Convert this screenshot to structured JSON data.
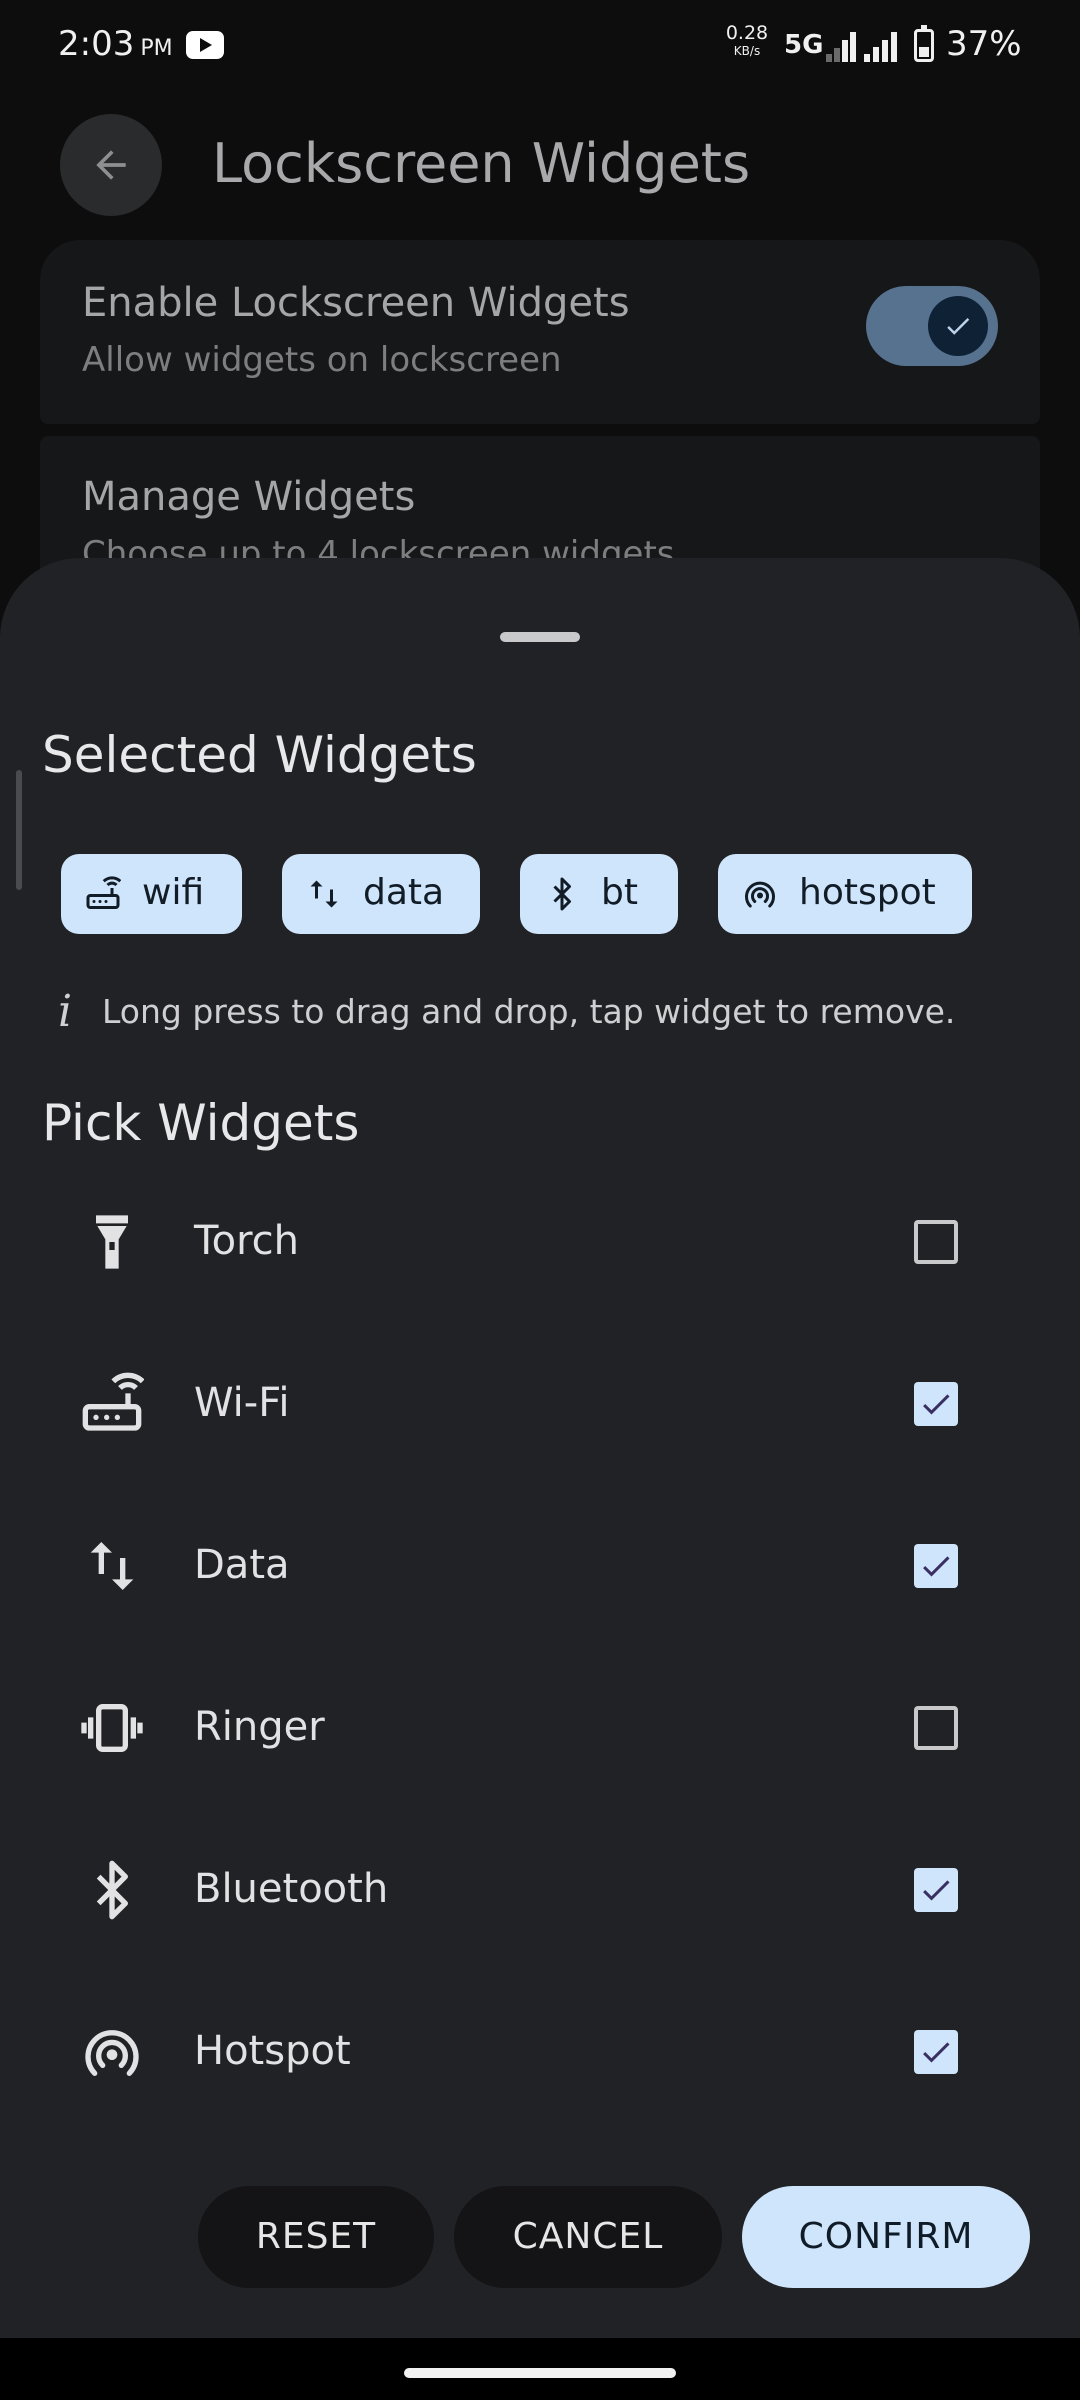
{
  "status_bar": {
    "time": "2:03",
    "ampm": "PM",
    "net_speed": "0.28",
    "net_speed_unit": "KB/s",
    "network": "5G",
    "battery": "37%"
  },
  "background": {
    "title": "Lockscreen Widgets",
    "enable_title": "Enable Lockscreen Widgets",
    "enable_subtitle": "Allow widgets on lockscreen",
    "enable_on": true,
    "manage_title": "Manage Widgets",
    "manage_subtitle": "Choose up to 4 lockscreen widgets"
  },
  "sheet": {
    "selected_heading": "Selected Widgets",
    "chips": [
      {
        "label": "wifi",
        "icon": "router-icon"
      },
      {
        "label": "data",
        "icon": "data-arrows-icon"
      },
      {
        "label": "bt",
        "icon": "bluetooth-icon"
      },
      {
        "label": "hotspot",
        "icon": "hotspot-icon"
      }
    ],
    "hint_icon": "i",
    "hint": "Long press to drag and drop, tap widget to remove.",
    "pick_heading": "Pick Widgets",
    "items": [
      {
        "label": "Torch",
        "icon": "torch-icon",
        "checked": false
      },
      {
        "label": "Wi-Fi",
        "icon": "router-icon",
        "checked": true
      },
      {
        "label": "Data",
        "icon": "data-arrows-icon",
        "checked": true
      },
      {
        "label": "Ringer",
        "icon": "vibrate-icon",
        "checked": false
      },
      {
        "label": "Bluetooth",
        "icon": "bluetooth-icon",
        "checked": true
      },
      {
        "label": "Hotspot",
        "icon": "hotspot-icon",
        "checked": true
      }
    ],
    "buttons": {
      "reset": "RESET",
      "cancel": "CANCEL",
      "confirm": "CONFIRM"
    }
  },
  "colors": {
    "accent": "#cfe5fb",
    "sheet": "#212226",
    "toggle": "#56728f"
  }
}
